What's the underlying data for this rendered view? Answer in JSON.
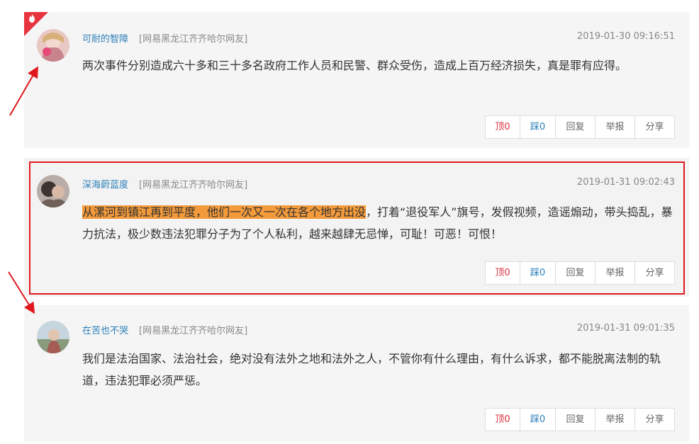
{
  "comments": [
    {
      "username": "可耐的智障",
      "location": "[网易黑龙江齐齐哈尔网友]",
      "time": "2019-01-30 09:16:51",
      "content": "两次事件分别造成六十多和三十多名政府工作人员和民警、群众受伤，造成上百万经济损失，真是罪有应得。",
      "up": "顶0",
      "down": "踩0",
      "reply": "回复",
      "report": "举报",
      "share": "分享"
    },
    {
      "username": "深海蔚蓝度",
      "location": "[网易黑龙江齐齐哈尔网友]",
      "time": "2019-01-31 09:02:43",
      "content_highlight": "从漯河到镇江再到平度，他们一次又一次在各个地方出没",
      "content_rest": "，打着“退役军人”旗号，发假视频，造谣煽动，带头捣乱，暴力抗法，极少数违法犯罪分子为了个人私利，越来越肆无忌惮，可耻！可恶！可恨！",
      "up": "顶0",
      "down": "踩0",
      "reply": "回复",
      "report": "举报",
      "share": "分享"
    },
    {
      "username": "在苦也不哭",
      "location": "[网易黑龙江齐齐哈尔网友]",
      "time": "2019-01-31 09:01:35",
      "content": "我们是法治国家、法治社会，绝对没有法外之地和法外之人，不管你有什么理由，有什么诉求，都不能脱离法制的轨道，违法犯罪必须严惩。",
      "up": "顶0",
      "down": "踩0",
      "reply": "回复",
      "report": "举报",
      "share": "分享"
    }
  ],
  "icons": {
    "hot_badge": "flame-icon",
    "annotation_arrows": "red-arrow"
  },
  "colors": {
    "username": "#2c7fb8",
    "highlight": "#f39a3b",
    "frame": "#e0181e",
    "up": "#d9333f",
    "down": "#2c7fb8"
  }
}
